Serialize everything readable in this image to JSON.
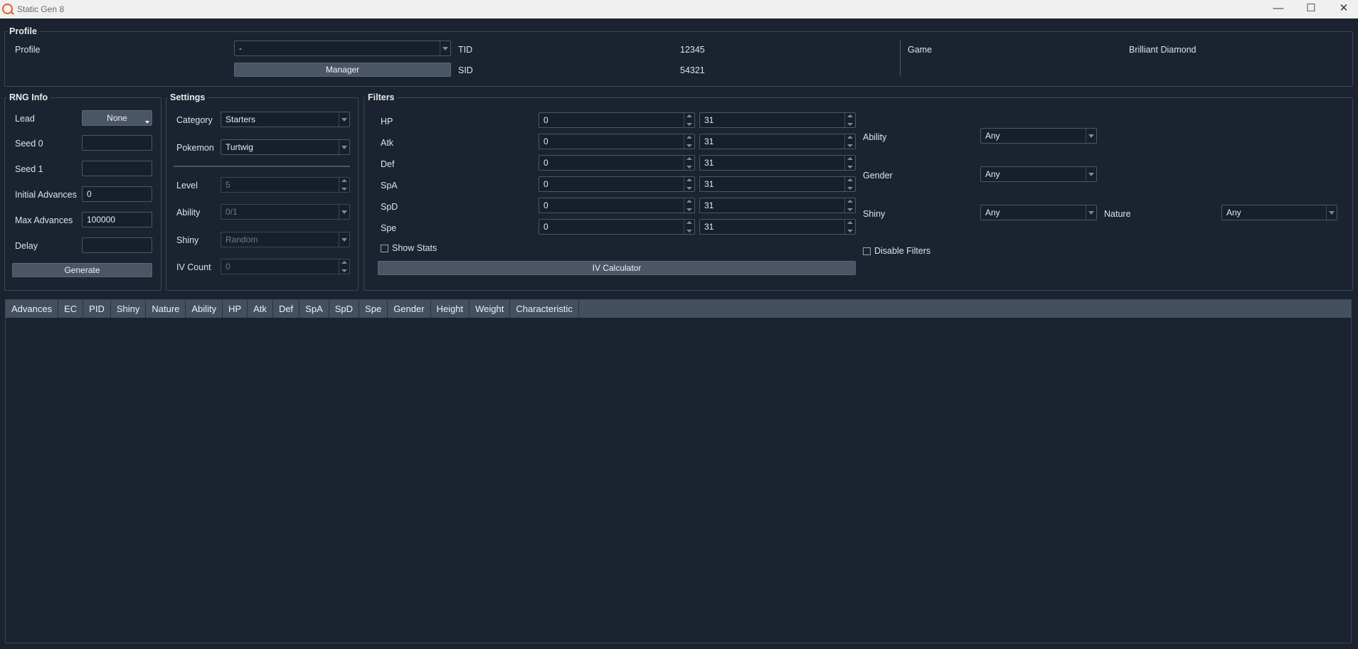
{
  "window": {
    "title": "Static Gen 8",
    "minimize": "—",
    "maximize": "☐",
    "close": "✕"
  },
  "profile": {
    "group_title": "Profile",
    "profile_label": "Profile",
    "profile_value": "-",
    "manager_button": "Manager",
    "tid_label": "TID",
    "tid_value": "12345",
    "sid_label": "SID",
    "sid_value": "54321",
    "game_label": "Game",
    "game_value": "Brilliant Diamond"
  },
  "rng": {
    "group_title": "RNG Info",
    "lead_label": "Lead",
    "lead_value": "None",
    "seed0_label": "Seed 0",
    "seed0_value": "",
    "seed1_label": "Seed 1",
    "seed1_value": "",
    "initial_label": "Initial Advances",
    "initial_value": "0",
    "max_label": "Max Advances",
    "max_value": "100000",
    "delay_label": "Delay",
    "delay_value": "",
    "generate_button": "Generate"
  },
  "settings": {
    "group_title": "Settings",
    "category_label": "Category",
    "category_value": "Starters",
    "pokemon_label": "Pokemon",
    "pokemon_value": "Turtwig",
    "level_label": "Level",
    "level_value": "5",
    "ability_label": "Ability",
    "ability_value": "0/1",
    "shiny_label": "Shiny",
    "shiny_value": "Random",
    "ivcount_label": "IV Count",
    "ivcount_value": "0"
  },
  "filters": {
    "group_title": "Filters",
    "ivs": [
      {
        "label": "HP",
        "min": "0",
        "max": "31"
      },
      {
        "label": "Atk",
        "min": "0",
        "max": "31"
      },
      {
        "label": "Def",
        "min": "0",
        "max": "31"
      },
      {
        "label": "SpA",
        "min": "0",
        "max": "31"
      },
      {
        "label": "SpD",
        "min": "0",
        "max": "31"
      },
      {
        "label": "Spe",
        "min": "0",
        "max": "31"
      }
    ],
    "show_stats_label": "Show Stats",
    "iv_calculator_button": "IV Calculator",
    "ability_label": "Ability",
    "ability_value": "Any",
    "gender_label": "Gender",
    "gender_value": "Any",
    "shiny_label": "Shiny",
    "shiny_value": "Any",
    "nature_label": "Nature",
    "nature_value": "Any",
    "disable_filters_label": "Disable Filters"
  },
  "table": {
    "columns": [
      "Advances",
      "EC",
      "PID",
      "Shiny",
      "Nature",
      "Ability",
      "HP",
      "Atk",
      "Def",
      "SpA",
      "SpD",
      "Spe",
      "Gender",
      "Height",
      "Weight",
      "Characteristic"
    ]
  }
}
